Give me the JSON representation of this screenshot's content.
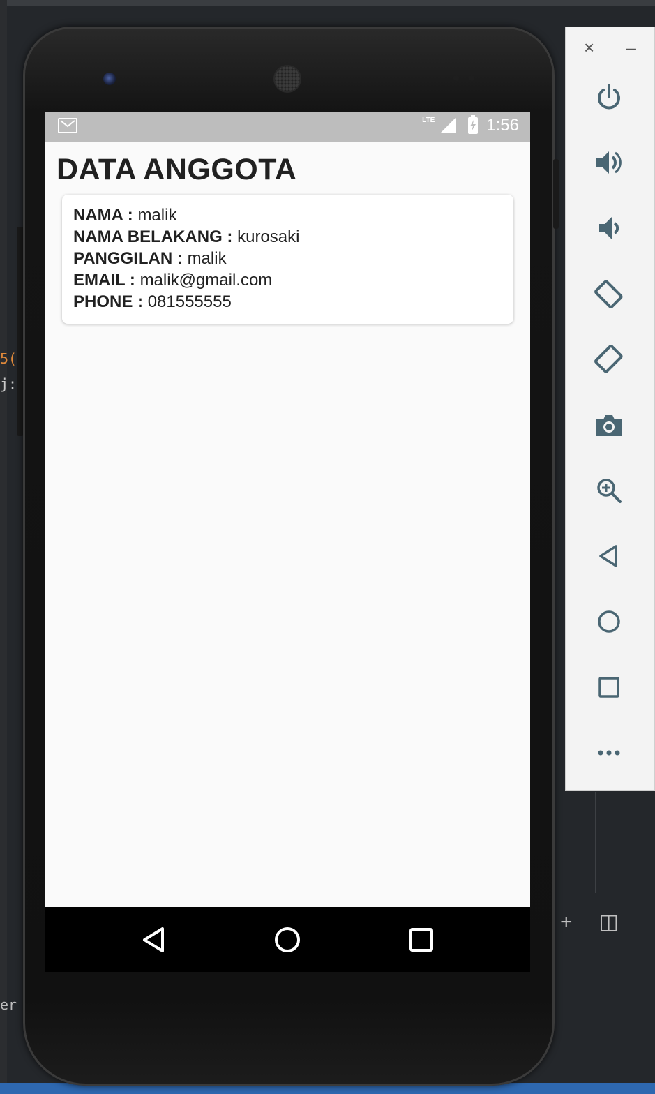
{
  "ide": {
    "snippet_1": "5(",
    "snippet_2": "j:",
    "snippet_3": "er",
    "add_tab": "+",
    "split": "◫"
  },
  "emulator": {
    "close": "×",
    "minimize": "–",
    "tools": [
      {
        "name": "power-icon"
      },
      {
        "name": "volume-up-icon"
      },
      {
        "name": "volume-down-icon"
      },
      {
        "name": "rotate-left-icon"
      },
      {
        "name": "rotate-right-icon"
      },
      {
        "name": "camera-icon"
      },
      {
        "name": "zoom-icon"
      },
      {
        "name": "back-icon"
      },
      {
        "name": "home-icon"
      },
      {
        "name": "overview-icon"
      },
      {
        "name": "more-icon"
      }
    ],
    "icon_color": "#4a6673"
  },
  "statusbar": {
    "network": "LTE",
    "time": "1:56"
  },
  "app": {
    "title": "DATA ANGGOTA",
    "member": {
      "nama_label": "NAMA :",
      "nama": "malik",
      "belakang_label": "NAMA BELAKANG :",
      "belakang": "kurosaki",
      "panggilan_label": "PANGGILAN :",
      "panggilan": "malik",
      "email_label": "EMAIL :",
      "email": "malik@gmail.com",
      "phone_label": "PHONE :",
      "phone": "081555555"
    }
  }
}
